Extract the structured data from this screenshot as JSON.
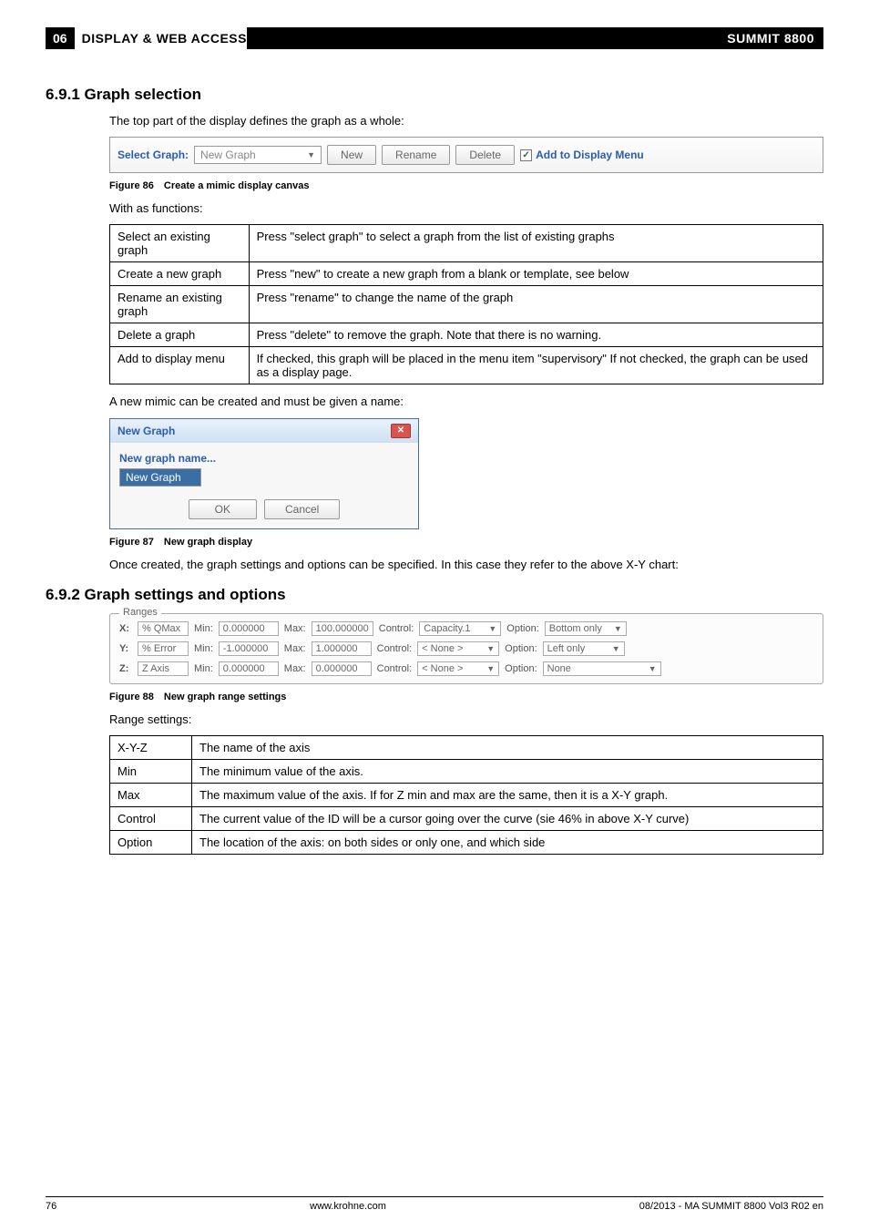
{
  "header": {
    "chapter_num": "06",
    "chapter_title": "DISPLAY & WEB ACCESS",
    "product": "SUMMIT 8800"
  },
  "s691": {
    "heading": "6.9.1 Graph selection",
    "intro": "The top part of the display defines the graph as a whole:",
    "toolbar": {
      "select_label": "Select Graph:",
      "select_value": "New Graph",
      "btn_new": "New",
      "btn_rename": "Rename",
      "btn_delete": "Delete",
      "chk_label": "Add to Display Menu"
    },
    "fig86": "Figure 86 Create a mimic display canvas",
    "func_intro": "With as functions:",
    "func_table": [
      [
        "Select an existing graph",
        "Press \"select graph\" to select a graph from the list of existing graphs"
      ],
      [
        "Create a new graph",
        "Press \"new\" to create a new graph from a blank or template, see below"
      ],
      [
        "Rename an existing graph",
        "Press \"rename\" to change the name of the graph"
      ],
      [
        "Delete a graph",
        "Press \"delete\" to remove the graph. Note that there is no warning."
      ],
      [
        "Add to display menu",
        "If checked, this graph will be placed in the menu item \"supervisory\" If not checked, the graph can be used as a display page."
      ]
    ],
    "mimic_intro": "A new mimic can be created and must be given a name:",
    "dialog": {
      "title": "New Graph",
      "label": "New graph name...",
      "value": "New Graph",
      "ok": "OK",
      "cancel": "Cancel"
    },
    "fig87": "Figure 87 New graph display",
    "after87": "Once created, the graph settings and options can be specified. In this case they refer to the above X-Y chart:"
  },
  "s692": {
    "heading": "6.9.2 Graph settings and options",
    "ranges_legend": "Ranges",
    "rows": [
      {
        "axis": "X:",
        "name": "% QMax",
        "min": "0.000000",
        "max": "100.000000",
        "ctrl": "Capacity.1",
        "opt": "Bottom only"
      },
      {
        "axis": "Y:",
        "name": "% Error",
        "min": "-1.000000",
        "max": "1.000000",
        "ctrl": "< None >",
        "opt": "Left only"
      },
      {
        "axis": "Z:",
        "name": "Z Axis",
        "min": "0.000000",
        "max": "0.000000",
        "ctrl": "< None >",
        "opt": "None"
      }
    ],
    "fig88": "Figure 88 New graph range settings",
    "range_intro": "Range settings:",
    "range_table": [
      [
        "X-Y-Z",
        "The name of the axis"
      ],
      [
        "Min",
        "The minimum value of the axis."
      ],
      [
        "Max",
        "The maximum value of the axis. If for Z min and max are the same, then it is a X-Y graph."
      ],
      [
        "Control",
        "The current value of the ID will be a cursor going over the curve (sie 46% in above X-Y curve)"
      ],
      [
        "Option",
        "The location of the axis: on both sides or only one, and which side"
      ]
    ]
  },
  "footer": {
    "page": "76",
    "url": "www.krohne.com",
    "docid": "08/2013 - MA SUMMIT 8800 Vol3 R02 en"
  },
  "labels": {
    "min": "Min:",
    "max": "Max:",
    "control": "Control:",
    "option": "Option:"
  }
}
